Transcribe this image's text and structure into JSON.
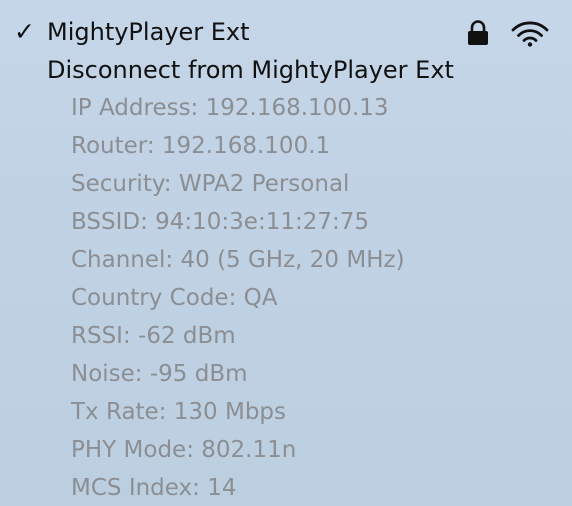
{
  "network": {
    "checkmark": "✓",
    "name": "MightyPlayer Ext",
    "lock_icon": "lock-icon",
    "wifi_icon": "wifi-icon",
    "wifi_strength_bars": 3
  },
  "actions": {
    "disconnect_label": "Disconnect from MightyPlayer Ext"
  },
  "details": [
    "IP Address: 192.168.100.13",
    "Router: 192.168.100.1",
    "Security: WPA2 Personal",
    "BSSID: 94:10:3e:11:27:75",
    "Channel: 40 (5 GHz, 20 MHz)",
    "Country Code: QA",
    "RSSI: -62 dBm",
    "Noise: -95 dBm",
    "Tx Rate: 130 Mbps",
    "PHY Mode: 802.11n",
    "MCS Index: 14"
  ],
  "colors": {
    "background": "#c0d2e4",
    "primary_text": "#111111",
    "detail_text": "#8b8e93"
  }
}
